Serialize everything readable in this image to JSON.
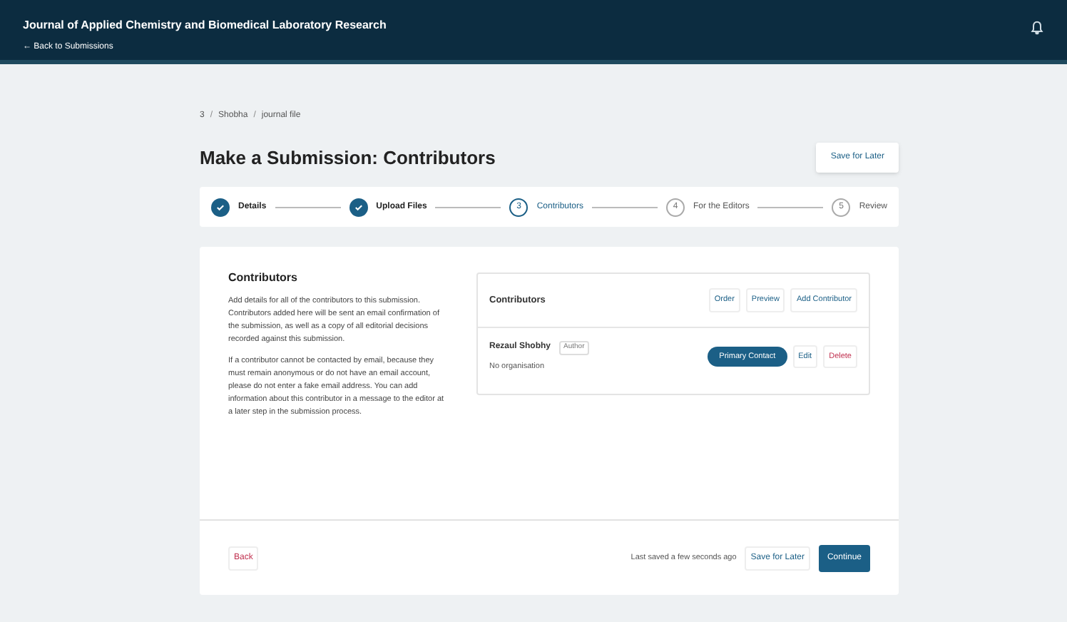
{
  "header": {
    "title": "Journal of Applied Chemistry and Biomedical Laboratory Research",
    "back_link": "← Back to Submissions"
  },
  "breadcrumbs": [
    {
      "label": "3"
    },
    {
      "separator": "/",
      "label": "Shobha"
    },
    {
      "separator": "/",
      "label": "journal file"
    }
  ],
  "page_title": "Make a Submission: Contributors",
  "save_later": "Save for Later",
  "steps": [
    {
      "label": "Details",
      "completed": true,
      "selected": false
    },
    {
      "label": "Upload Files",
      "completed": true,
      "selected": false
    },
    {
      "number": "3",
      "label": "Contributors",
      "completed": false,
      "selected": true
    },
    {
      "number": "4",
      "label": "For the Editors",
      "completed": false,
      "selected": false
    },
    {
      "number": "5",
      "label": "Review",
      "completed": false,
      "selected": false
    }
  ],
  "intro": {
    "heading": "Contributors",
    "paragraphs": [
      "Add details for all of the contributors to this submission. Contributors added here will be sent an email confirmation of the submission, as well as a copy of all editorial decisions recorded against this submission.",
      "If a contributor cannot be contacted by email, because they must remain anonymous or do not have an email account, please do not enter a fake email address. You can add information about this contributor in a message to the editor at a later step in the submission process."
    ]
  },
  "contributors_panel": {
    "title": "Contributors",
    "actions": [
      "Order",
      "Preview",
      "Add Contributor"
    ],
    "rows": [
      {
        "name": "Rezaul Shobhy",
        "role": "Author",
        "affiliation": "No organisation",
        "primary_contact": "Primary Contact",
        "edit": "Edit",
        "delete": "Delete"
      }
    ]
  },
  "footer": {
    "back": "Back",
    "last_saved": "Last saved a few seconds ago",
    "save_later": "Save for Later",
    "continue": "Continue"
  }
}
